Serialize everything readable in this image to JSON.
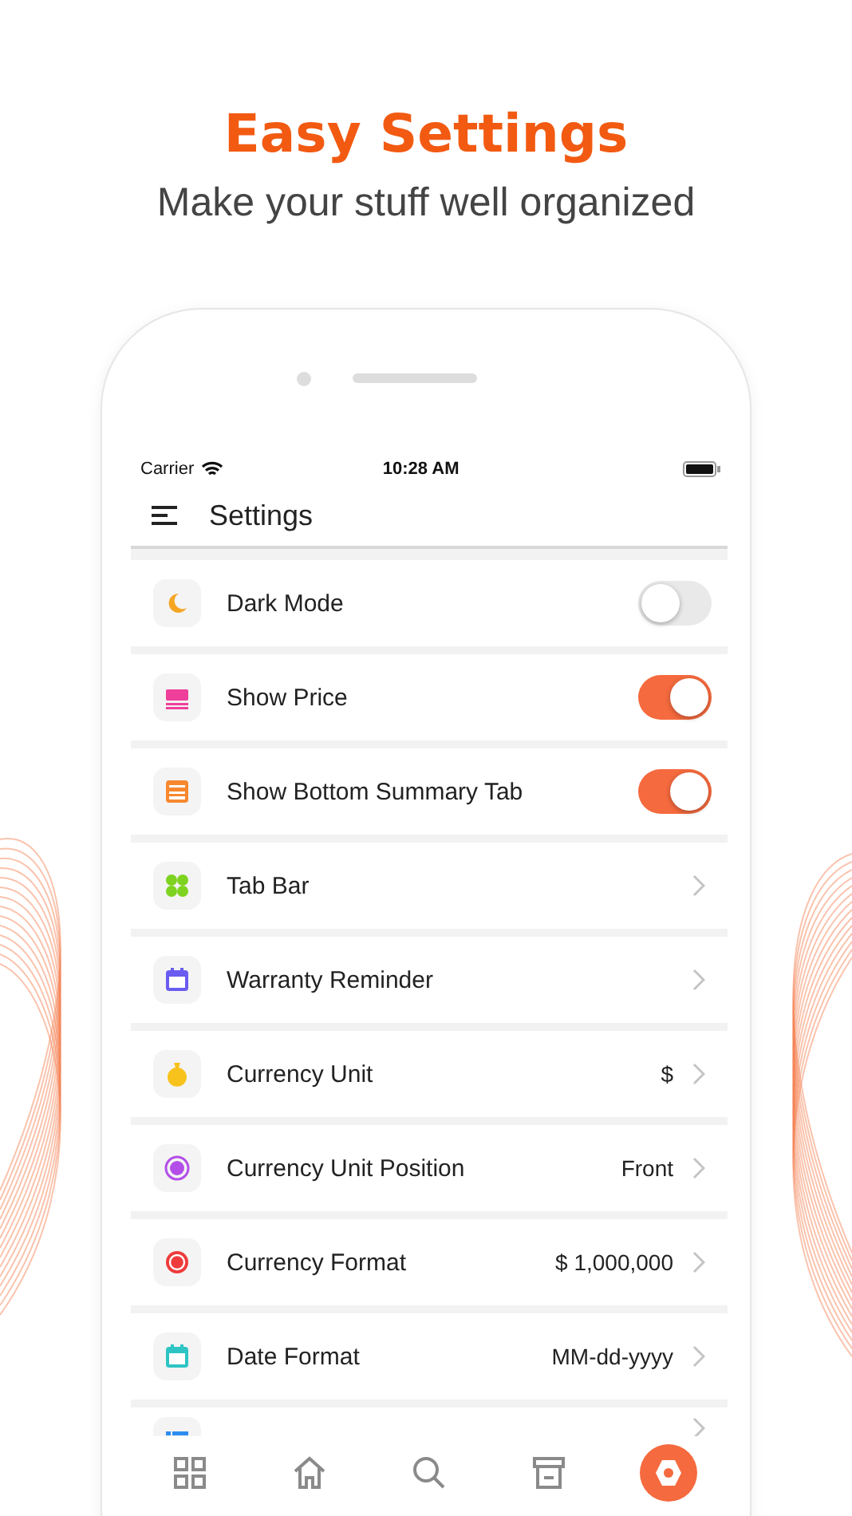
{
  "headline": "Easy Settings",
  "subtitle": "Make your stuff well organized",
  "status_bar": {
    "carrier": "Carrier",
    "time": "10:28 AM"
  },
  "header": {
    "title": "Settings"
  },
  "settings": [
    {
      "kind": "toggle",
      "label": "Dark Mode",
      "on": false,
      "color": "#f5a623"
    },
    {
      "kind": "toggle",
      "label": "Show Price",
      "on": true,
      "color": "#ee3f9a"
    },
    {
      "kind": "toggle",
      "label": "Show Bottom Summary Tab",
      "on": true,
      "color": "#f7882f"
    },
    {
      "kind": "link",
      "label": "Tab Bar",
      "color": "#7ed321"
    },
    {
      "kind": "link",
      "label": "Warranty Reminder",
      "color": "#6a5cf0"
    },
    {
      "kind": "link",
      "label": "Currency Unit",
      "value": "$",
      "color": "#f8c21c"
    },
    {
      "kind": "link",
      "label": "Currency Unit Position",
      "value": "Front",
      "color": "#b34ee8"
    },
    {
      "kind": "link",
      "label": "Currency Format",
      "value": "$ 1,000,000",
      "color": "#ef3b3b"
    },
    {
      "kind": "link",
      "label": "Date Format",
      "value": "MM-dd-yyyy",
      "color": "#2ec4c4"
    },
    {
      "kind": "partial",
      "color": "#2d8cf0"
    }
  ],
  "tab_bar": [
    {
      "selected": false
    },
    {
      "selected": false
    },
    {
      "selected": false
    },
    {
      "selected": false
    },
    {
      "selected": true
    }
  ]
}
